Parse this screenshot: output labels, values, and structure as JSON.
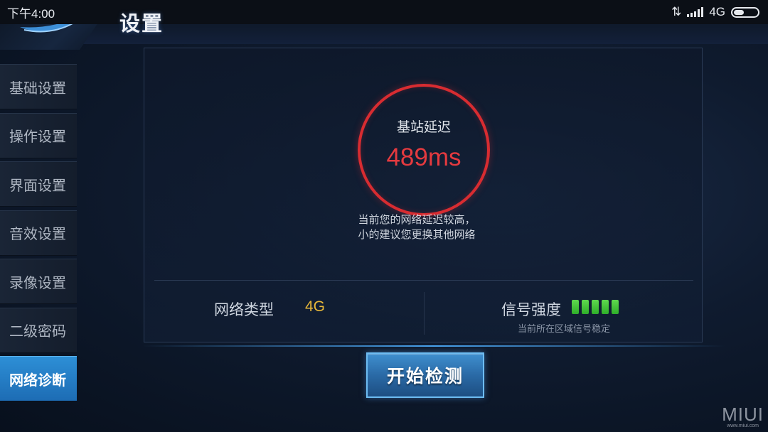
{
  "status_bar": {
    "time": "下午4:00",
    "network": "4G"
  },
  "header": {
    "title": "设置"
  },
  "sidebar": {
    "items": [
      {
        "label": "基础设置"
      },
      {
        "label": "操作设置"
      },
      {
        "label": "界面设置"
      },
      {
        "label": "音效设置"
      },
      {
        "label": "录像设置"
      },
      {
        "label": "二级密码"
      },
      {
        "label": "网络诊断",
        "active": true
      }
    ]
  },
  "diagnosis": {
    "latency_label": "基站延迟",
    "latency_value": "489ms",
    "advice_line1": "当前您的网络延迟较高，",
    "advice_line2": "小的建议您更换其他网络",
    "network_type_label": "网络类型",
    "network_type_value": "4G",
    "signal_label": "信号强度",
    "signal_bars_filled": 5,
    "signal_bars_total": 5,
    "signal_note": "当前所在区域信号稳定",
    "start_button_label": "开始检测"
  },
  "watermark": {
    "brand": "MIUI",
    "url": "www.miui.com"
  },
  "colors": {
    "latency_ring": "#d82c31",
    "latency_text": "#e53a3f",
    "network_type": "#e8b83a",
    "signal_bar": "#3fbf35",
    "active_tab": "#2a85cf"
  }
}
